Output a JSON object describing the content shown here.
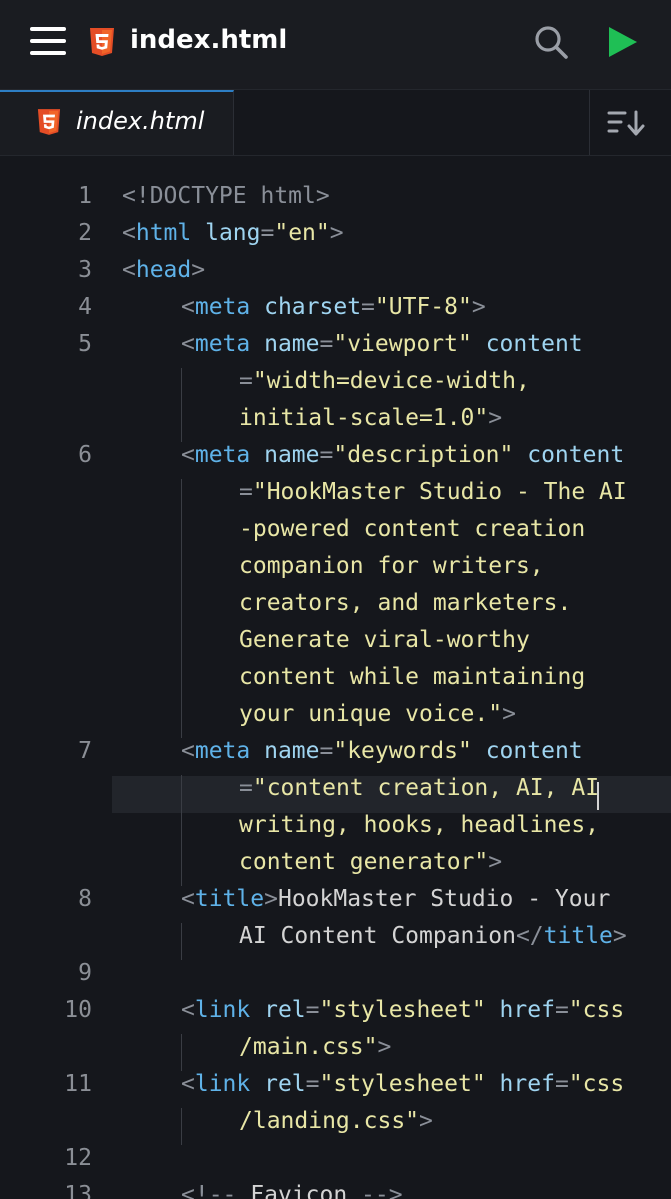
{
  "app": {
    "file_title": "index.html",
    "icons": {
      "menu": "hamburger-menu-icon",
      "file": "html5-icon",
      "search": "search-icon",
      "run": "play-icon",
      "sort": "sort-icon"
    }
  },
  "tabs": [
    {
      "label": "index.html",
      "active": true
    }
  ],
  "colors": {
    "background": "#15171c",
    "tag": "#5fb2e8",
    "attribute": "#9fd4f0",
    "string": "#e8e6a6",
    "punctuation": "#8a8f98",
    "run_button": "#1fbf55",
    "html5_icon": "#e44d26"
  },
  "editor": {
    "line_numbers": [
      "1",
      "2",
      "3",
      "4",
      "5",
      "6",
      "7",
      "8",
      "9",
      "10",
      "11",
      "12",
      "13"
    ],
    "current_line": "7",
    "code": [
      [
        {
          "t": "doctype",
          "v": "<!DOCTYPE html>"
        }
      ],
      [
        {
          "t": "punc",
          "v": "<"
        },
        {
          "t": "tag",
          "v": "html"
        },
        {
          "t": "text",
          "v": " "
        },
        {
          "t": "attr",
          "v": "lang"
        },
        {
          "t": "punc",
          "v": "="
        },
        {
          "t": "str",
          "v": "\"en\""
        },
        {
          "t": "punc",
          "v": ">"
        }
      ],
      [
        {
          "t": "punc",
          "v": "<"
        },
        {
          "t": "tag",
          "v": "head"
        },
        {
          "t": "punc",
          "v": ">"
        }
      ],
      [
        {
          "t": "punc",
          "v": "<"
        },
        {
          "t": "tag",
          "v": "meta"
        },
        {
          "t": "text",
          "v": " "
        },
        {
          "t": "attr",
          "v": "charset"
        },
        {
          "t": "punc",
          "v": "="
        },
        {
          "t": "str",
          "v": "\"UTF-8\""
        },
        {
          "t": "punc",
          "v": ">"
        }
      ],
      [
        {
          "t": "punc",
          "v": "<"
        },
        {
          "t": "tag",
          "v": "meta"
        },
        {
          "t": "text",
          "v": " "
        },
        {
          "t": "attr",
          "v": "name"
        },
        {
          "t": "punc",
          "v": "="
        },
        {
          "t": "str",
          "v": "\"viewport\""
        },
        {
          "t": "text",
          "v": " "
        },
        {
          "t": "attr",
          "v": "content"
        }
      ],
      [
        {
          "t": "punc",
          "v": "="
        },
        {
          "t": "str",
          "v": "\"width=device-width,"
        }
      ],
      [
        {
          "t": "str",
          "v": "initial-scale=1.0\""
        },
        {
          "t": "punc",
          "v": ">"
        }
      ],
      [
        {
          "t": "punc",
          "v": "<"
        },
        {
          "t": "tag",
          "v": "meta"
        },
        {
          "t": "text",
          "v": " "
        },
        {
          "t": "attr",
          "v": "name"
        },
        {
          "t": "punc",
          "v": "="
        },
        {
          "t": "str",
          "v": "\"description\""
        },
        {
          "t": "text",
          "v": " "
        },
        {
          "t": "attr",
          "v": "content"
        }
      ],
      [
        {
          "t": "punc",
          "v": "="
        },
        {
          "t": "str",
          "v": "\"HookMaster Studio - The AI"
        }
      ],
      [
        {
          "t": "str",
          "v": "-powered content creation"
        }
      ],
      [
        {
          "t": "str",
          "v": "companion for writers,"
        }
      ],
      [
        {
          "t": "str",
          "v": "creators, and marketers."
        }
      ],
      [
        {
          "t": "str",
          "v": "Generate viral-worthy"
        }
      ],
      [
        {
          "t": "str",
          "v": "content while maintaining"
        }
      ],
      [
        {
          "t": "str",
          "v": "your unique voice.\""
        },
        {
          "t": "punc",
          "v": ">"
        }
      ],
      [
        {
          "t": "punc",
          "v": "<"
        },
        {
          "t": "tag",
          "v": "meta"
        },
        {
          "t": "text",
          "v": " "
        },
        {
          "t": "attr",
          "v": "name"
        },
        {
          "t": "punc",
          "v": "="
        },
        {
          "t": "str",
          "v": "\"keywords\""
        },
        {
          "t": "text",
          "v": " "
        },
        {
          "t": "attr",
          "v": "content"
        }
      ],
      [
        {
          "t": "punc",
          "v": "="
        },
        {
          "t": "str",
          "v": "\"content creation, AI, AI"
        }
      ],
      [
        {
          "t": "str",
          "v": "writing, hooks, headlines,"
        }
      ],
      [
        {
          "t": "str",
          "v": "content generator\""
        },
        {
          "t": "punc",
          "v": ">"
        }
      ],
      [
        {
          "t": "punc",
          "v": "<"
        },
        {
          "t": "tag",
          "v": "title"
        },
        {
          "t": "punc",
          "v": ">"
        },
        {
          "t": "text",
          "v": "HookMaster Studio - Your"
        }
      ],
      [
        {
          "t": "text",
          "v": "AI Content Companion"
        },
        {
          "t": "punc",
          "v": "</"
        },
        {
          "t": "tag",
          "v": "title"
        },
        {
          "t": "punc",
          "v": ">"
        }
      ],
      [],
      [
        {
          "t": "punc",
          "v": "<"
        },
        {
          "t": "tag",
          "v": "link"
        },
        {
          "t": "text",
          "v": " "
        },
        {
          "t": "attr",
          "v": "rel"
        },
        {
          "t": "punc",
          "v": "="
        },
        {
          "t": "str",
          "v": "\"stylesheet\""
        },
        {
          "t": "text",
          "v": " "
        },
        {
          "t": "attr",
          "v": "href"
        },
        {
          "t": "punc",
          "v": "="
        },
        {
          "t": "str",
          "v": "\"css"
        }
      ],
      [
        {
          "t": "str",
          "v": "/main.css\""
        },
        {
          "t": "punc",
          "v": ">"
        }
      ],
      [
        {
          "t": "punc",
          "v": "<"
        },
        {
          "t": "tag",
          "v": "link"
        },
        {
          "t": "text",
          "v": " "
        },
        {
          "t": "attr",
          "v": "rel"
        },
        {
          "t": "punc",
          "v": "="
        },
        {
          "t": "str",
          "v": "\"stylesheet\""
        },
        {
          "t": "text",
          "v": " "
        },
        {
          "t": "attr",
          "v": "href"
        },
        {
          "t": "punc",
          "v": "="
        },
        {
          "t": "str",
          "v": "\"css"
        }
      ],
      [
        {
          "t": "str",
          "v": "/landing.css\""
        },
        {
          "t": "punc",
          "v": ">"
        }
      ],
      [],
      [
        {
          "t": "punc",
          "v": "<!-- "
        },
        {
          "t": "text",
          "v": "Favicon"
        },
        {
          "t": "punc",
          "v": " -->"
        }
      ]
    ]
  }
}
